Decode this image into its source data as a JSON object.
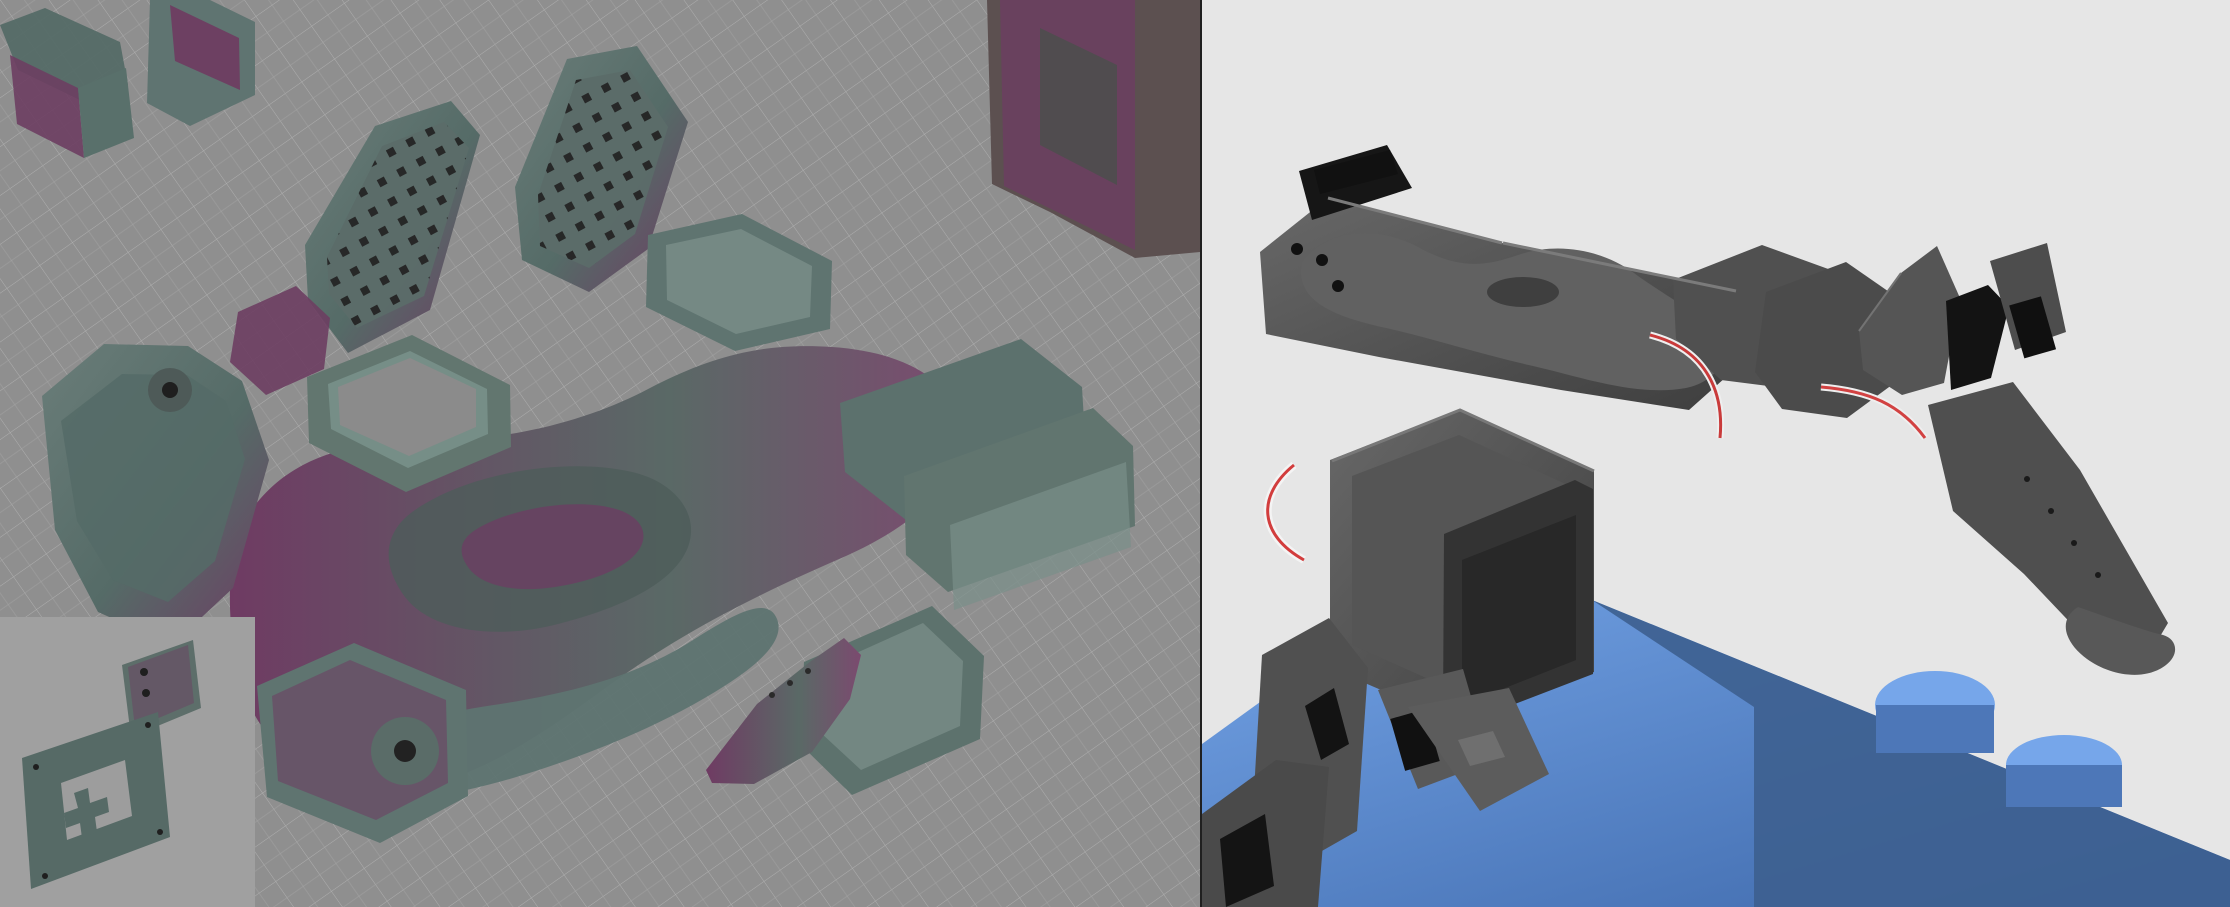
{
  "scene": {
    "description_hidden": "",
    "layout": "split-view",
    "left_panel": {
      "name": "print-layout-view",
      "floor_color": "#8f8f8f",
      "grid_color": "#b7b7b7",
      "part_primary_color": "#556b67",
      "part_accent_color": "#6e3c63"
    },
    "right_panel": {
      "name": "assembled-robot-view",
      "background_color": "#e6e6e6",
      "robot_color": "#4f4f4f",
      "servo_color": "#151515",
      "base_color": "#4f86c6"
    }
  }
}
